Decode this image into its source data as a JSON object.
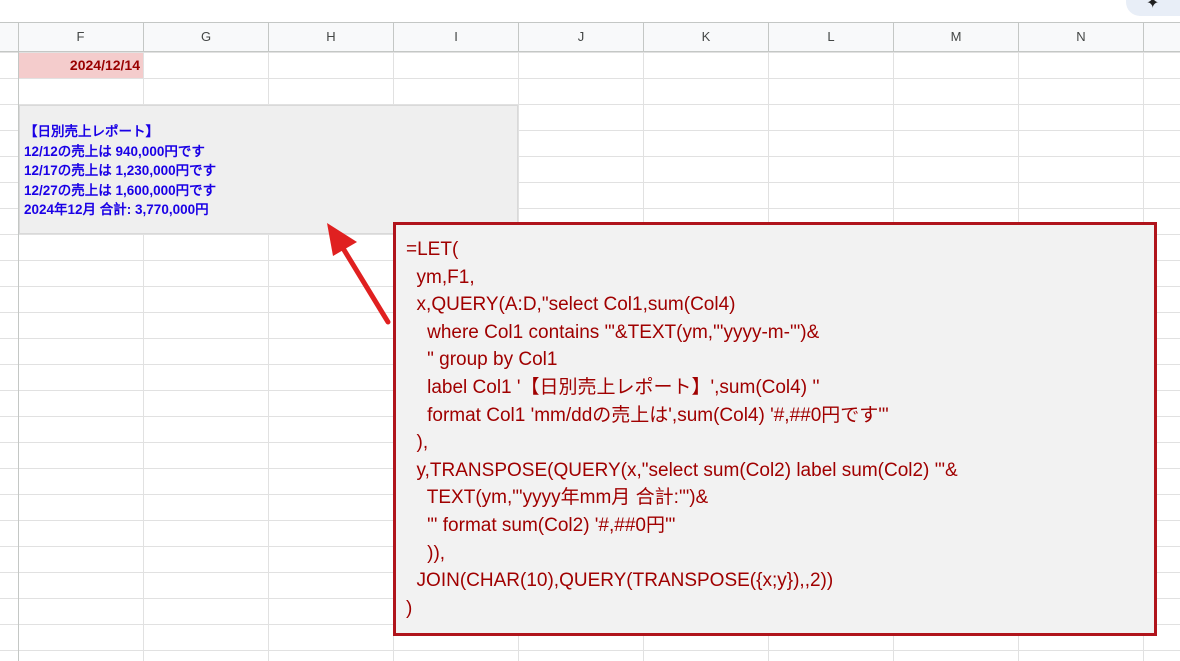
{
  "toolbar": {
    "sparkle_icon_glyph": "✦"
  },
  "columns": [
    "F",
    "G",
    "H",
    "I",
    "J",
    "K",
    "L",
    "M",
    "N"
  ],
  "cells": {
    "date_value": "2024/12/14",
    "report": {
      "lines": [
        "【日別売上レポート】",
        "12/12の売上は 940,000円です",
        "12/17の売上は 1,230,000円です",
        "12/27の売上は 1,600,000円です",
        "2024年12月 合計: 3,770,000円"
      ]
    }
  },
  "formula": {
    "lines": [
      "=LET(",
      "  ym,F1,",
      "  x,QUERY(A:D,\"select Col1,sum(Col4)",
      "    where Col1 contains '\"&TEXT(ym,\"'yyyy-m-'\")&",
      "    \" group by Col1",
      "    label Col1 '【日別売上レポート】',sum(Col4) ''",
      "    format Col1 'mm/ddの売上は',sum(Col4) '#,##0円です'\"",
      "  ),",
      "  y,TRANSPOSE(QUERY(x,\"select sum(Col2) label sum(Col2) '\"&",
      "    TEXT(ym,\"'yyyy年mm月 合計:'\")&",
      "    \"' format sum(Col2) '#,##0円'\"",
      "    )),",
      "  JOIN(CHAR(10),QUERY(TRANSPOSE({x;y}),,2))",
      ")"
    ]
  },
  "colors": {
    "date_cell_bg": "#f4cccc",
    "date_cell_text": "#990000",
    "report_text": "#1a00e6",
    "report_bg": "#efefef",
    "callout_border": "#b0141c",
    "callout_text": "#a00000",
    "arrow": "#e02020"
  }
}
